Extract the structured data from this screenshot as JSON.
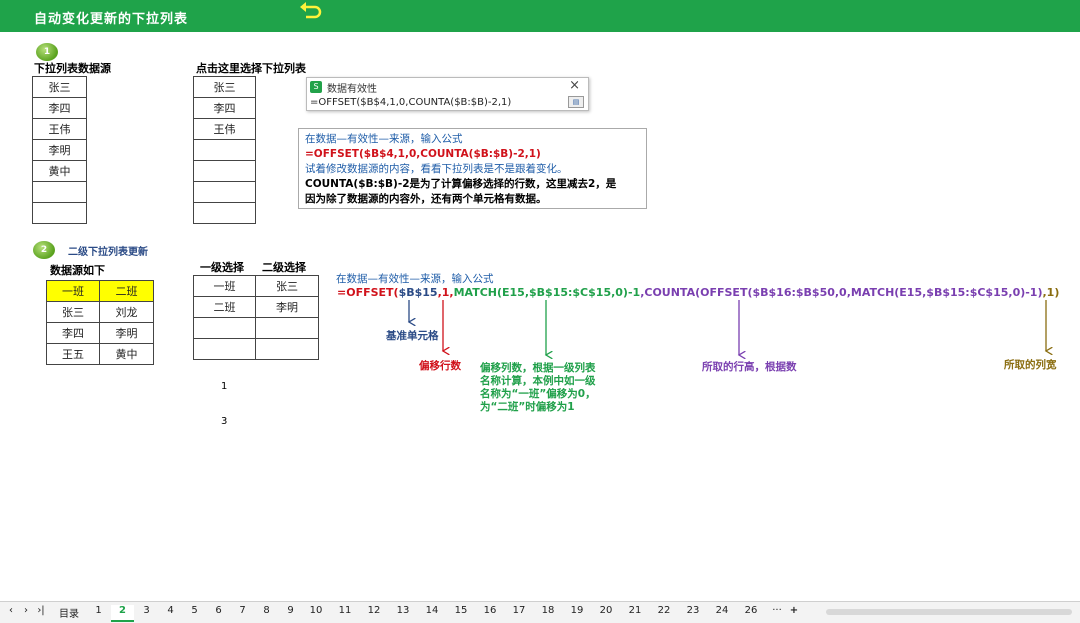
{
  "header": {
    "title": "自动变化更新的下拉列表",
    "back_icon": "undo-arrow-icon",
    "color": "#1fa34a"
  },
  "section1": {
    "badge": "1",
    "source_title": "下拉列表数据源",
    "source_items": [
      "张三",
      "李四",
      "王伟",
      "李明",
      "黄中",
      "",
      ""
    ],
    "select_title": "点击这里选择下拉列表",
    "select_items": [
      "张三",
      "李四",
      "王伟",
      "",
      "",
      "",
      ""
    ],
    "popup": {
      "title": "数据有效性",
      "formula": "=OFFSET($B$4,1,0,COUNTA($B:$B)-2,1)",
      "close": "×"
    },
    "note": {
      "line1": "在数据—有效性—来源，输入公式",
      "line2": "=OFFSET($B$4,1,0,COUNTA($B:$B)-2,1)",
      "line3": "试着修改数据源的内容，看看下拉列表是不是跟着变化。",
      "line4": "COUNTA($B:$B)-2是为了计算偏移选择的行数，这里减去2，是",
      "line5": "因为除了数据源的内容外，还有两个单元格有数据。"
    }
  },
  "section2": {
    "badge": "2",
    "title": "二级下拉列表更新",
    "source_title": "数据源如下",
    "source_header": [
      "一班",
      "二班"
    ],
    "source_rows": [
      [
        "张三",
        "刘龙"
      ],
      [
        "李四",
        "李明"
      ],
      [
        "王五",
        "黄中"
      ]
    ],
    "select_headers": [
      "一级选择",
      "二级选择"
    ],
    "select_rows": [
      [
        "一班",
        "张三"
      ],
      [
        "二班",
        "李明"
      ],
      [
        "",
        ""
      ],
      [
        "",
        ""
      ]
    ],
    "num1": "1",
    "num3": "3",
    "formula_intro": "在数据—有效性—来源，输入公式",
    "formula_parts": [
      "=OFFSET(",
      "$B$15",
      ",1,",
      "MATCH(E15,$B$15:$C$15,0)-1",
      ",",
      "COUNTA(OFFSET($B$16:$B$50,0,MATCH(E15,$B$15:$C$15,0)-1)",
      ",1)"
    ],
    "labels": {
      "base": "基准单元格",
      "rows": "偏移行数",
      "cols": "偏移列数，根据一级列表名称计算，本例中如一级名称为“一班”偏移为0，为“二班”时偏移为1",
      "cols_lines": [
        "偏移列数，根据一级列表",
        "名称计算，本例中如一级",
        "名称为“一班”偏移为0，",
        "为“二班”时偏移为1"
      ],
      "height": "所取的行高，根据数",
      "width": "所取的列宽"
    }
  },
  "tabs": {
    "nav": [
      "‹",
      "›",
      "›|"
    ],
    "items": [
      "目录",
      "1",
      "2",
      "3",
      "4",
      "5",
      "6",
      "7",
      "8",
      "9",
      "10",
      "11",
      "12",
      "13",
      "14",
      "15",
      "16",
      "17",
      "18",
      "19",
      "20",
      "21",
      "22",
      "23",
      "24",
      "26"
    ],
    "active": "2",
    "more": "···",
    "add": "+"
  }
}
